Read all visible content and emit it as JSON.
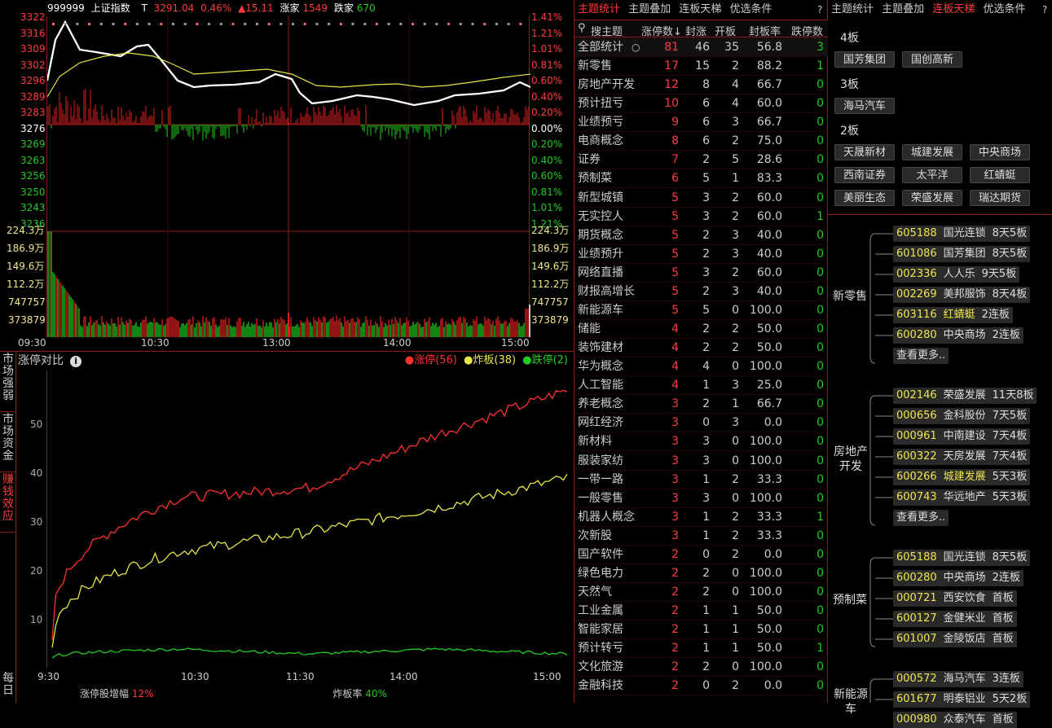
{
  "index_bar": {
    "code": "999999",
    "name": "上证指数",
    "tag": "T",
    "price": "3291.04",
    "pct": "0.46%",
    "change": "▲15.11",
    "up_label": "涨家",
    "up_count": "1549",
    "down_label": "跌家",
    "down_count": "670"
  },
  "price_axis_left": [
    "3322",
    "3316",
    "3309",
    "3302",
    "3296",
    "3289",
    "3283",
    "3276",
    "3269",
    "3263",
    "3256",
    "3250",
    "3243",
    "3236"
  ],
  "price_axis_right": [
    "1.41%",
    "1.21%",
    "1.01%",
    "0.81%",
    "0.60%",
    "0.40%",
    "0.20%",
    "0.00%",
    "0.20%",
    "0.40%",
    "0.60%",
    "0.81%",
    "1.01%",
    "1.21%"
  ],
  "volume_axis": [
    "224.3万",
    "186.9万",
    "149.6万",
    "112.2万",
    "747757",
    "373879"
  ],
  "time_axis": [
    "09:30",
    "10:30",
    "13:00",
    "14:00",
    "15:00"
  ],
  "side_tabs": [
    "市场强弱",
    "市场资金",
    "赚钱效应",
    "每日"
  ],
  "panel2": {
    "title": "涨停对比",
    "legend": [
      {
        "label": "涨停(56)",
        "color": "#ff3030"
      },
      {
        "label": "炸板(38)",
        "color": "#e6e64a"
      },
      {
        "label": "跌停(2)",
        "color": "#22cc22"
      }
    ],
    "footer_a_label": "涨停股增幅",
    "footer_a_value": "12%",
    "footer_b_label": "炸板率",
    "footer_b_value": "40%",
    "x_ticks": [
      "9:30",
      "10:30",
      "11:30",
      "14:00",
      "15:00"
    ],
    "y_ticks": [
      "50",
      "40",
      "30",
      "20",
      "10"
    ]
  },
  "chart_data": {
    "type": "line",
    "x": [
      "9:30",
      "10:30",
      "11:30",
      "14:00",
      "15:00"
    ],
    "ylim": [
      0,
      60
    ],
    "series": [
      {
        "name": "涨停(56)",
        "color": "#ff3030",
        "values": [
          5,
          34,
          36,
          47,
          56
        ]
      },
      {
        "name": "炸板(38)",
        "color": "#e6e64a",
        "values": [
          3,
          23,
          27,
          32,
          38
        ]
      },
      {
        "name": "跌停(2)",
        "color": "#22cc22",
        "values": [
          1,
          3,
          2,
          3,
          2
        ]
      }
    ]
  },
  "mid": {
    "tabs": [
      "主题统计",
      "主题叠加",
      "连板天梯",
      "优选条件",
      "?"
    ],
    "search_placeholder": "搜主题",
    "headers": [
      "涨停数↓",
      "封涨",
      "开板",
      "封板率",
      "跌停数"
    ],
    "rows": [
      [
        "全部统计",
        "81",
        "46",
        "35",
        "56.8",
        "3"
      ],
      [
        "新零售",
        "17",
        "15",
        "2",
        "88.2",
        "1"
      ],
      [
        "房地产开发",
        "12",
        "8",
        "4",
        "66.7",
        "0"
      ],
      [
        "预计扭亏",
        "10",
        "6",
        "4",
        "60.0",
        "0"
      ],
      [
        "业绩预亏",
        "9",
        "6",
        "3",
        "66.7",
        "0"
      ],
      [
        "电商概念",
        "8",
        "6",
        "2",
        "75.0",
        "0"
      ],
      [
        "证券",
        "7",
        "2",
        "5",
        "28.6",
        "0"
      ],
      [
        "预制菜",
        "6",
        "5",
        "1",
        "83.3",
        "0"
      ],
      [
        "新型城镇",
        "5",
        "3",
        "2",
        "60.0",
        "0"
      ],
      [
        "无实控人",
        "5",
        "3",
        "2",
        "60.0",
        "1"
      ],
      [
        "期货概念",
        "5",
        "2",
        "3",
        "40.0",
        "0"
      ],
      [
        "业绩预升",
        "5",
        "2",
        "3",
        "40.0",
        "0"
      ],
      [
        "网络直播",
        "5",
        "3",
        "2",
        "60.0",
        "0"
      ],
      [
        "财报高增长",
        "5",
        "2",
        "3",
        "40.0",
        "0"
      ],
      [
        "新能源车",
        "5",
        "5",
        "0",
        "100.0",
        "0"
      ],
      [
        "储能",
        "4",
        "2",
        "2",
        "50.0",
        "0"
      ],
      [
        "装饰建材",
        "4",
        "2",
        "2",
        "50.0",
        "0"
      ],
      [
        "华为概念",
        "4",
        "4",
        "0",
        "100.0",
        "0"
      ],
      [
        "人工智能",
        "4",
        "1",
        "3",
        "25.0",
        "0"
      ],
      [
        "养老概念",
        "3",
        "2",
        "1",
        "66.7",
        "0"
      ],
      [
        "网红经济",
        "3",
        "0",
        "3",
        "0.0",
        "0"
      ],
      [
        "新材料",
        "3",
        "3",
        "0",
        "100.0",
        "0"
      ],
      [
        "服装家纺",
        "3",
        "3",
        "0",
        "100.0",
        "0"
      ],
      [
        "一带一路",
        "3",
        "1",
        "2",
        "33.3",
        "0"
      ],
      [
        "一般零售",
        "3",
        "3",
        "0",
        "100.0",
        "0"
      ],
      [
        "机器人概念",
        "3",
        "1",
        "2",
        "33.3",
        "1"
      ],
      [
        "次新股",
        "3",
        "1",
        "2",
        "33.3",
        "0"
      ],
      [
        "国产软件",
        "2",
        "0",
        "2",
        "0.0",
        "0"
      ],
      [
        "绿色电力",
        "2",
        "2",
        "0",
        "100.0",
        "0"
      ],
      [
        "天然气",
        "2",
        "2",
        "0",
        "100.0",
        "0"
      ],
      [
        "工业金属",
        "2",
        "1",
        "1",
        "50.0",
        "0"
      ],
      [
        "智能家居",
        "2",
        "1",
        "1",
        "50.0",
        "0"
      ],
      [
        "预计转亏",
        "2",
        "1",
        "1",
        "50.0",
        "1"
      ],
      [
        "文化旅游",
        "2",
        "2",
        "0",
        "100.0",
        "0"
      ],
      [
        "金融科技",
        "2",
        "0",
        "2",
        "0.0",
        "0"
      ]
    ]
  },
  "right": {
    "tabs": [
      "主题统计",
      "主题叠加",
      "连板天梯",
      "优选条件",
      "?"
    ],
    "levels": [
      {
        "title": "4板",
        "chips": [
          "国芳集团",
          "国创高新"
        ]
      },
      {
        "title": "3板",
        "chips": [
          "海马汽车"
        ]
      },
      {
        "title": "2板",
        "chips": [
          "天晟新材",
          "城建发展",
          "中央商场",
          "西南证券",
          "太平洋",
          "红蜻蜓",
          "美丽生态",
          "荣盛发展",
          "瑞达期货"
        ]
      }
    ],
    "groups": [
      {
        "name": "新零售",
        "stocks": [
          [
            "605188",
            "国光连锁",
            "8天5板"
          ],
          [
            "601086",
            "国芳集团",
            "8天5板"
          ],
          [
            "002336",
            "人人乐",
            "9天5板"
          ],
          [
            "002269",
            "美邦服饰",
            "8天4板"
          ],
          [
            "603116",
            "红蜻蜓",
            "2连板"
          ],
          [
            "600280",
            "中央商场",
            "2连板"
          ]
        ],
        "more": "查看更多.."
      },
      {
        "name": "房地产开发",
        "stocks": [
          [
            "002146",
            "荣盛发展",
            "11天8板"
          ],
          [
            "000656",
            "金科股份",
            "7天5板"
          ],
          [
            "000961",
            "中南建设",
            "7天4板"
          ],
          [
            "600322",
            "天房发展",
            "7天4板"
          ],
          [
            "600266",
            "城建发展",
            "5天3板"
          ],
          [
            "600743",
            "华远地产",
            "5天3板"
          ]
        ],
        "more": "查看更多.."
      },
      {
        "name": "预制菜",
        "stocks": [
          [
            "605188",
            "国光连锁",
            "8天5板"
          ],
          [
            "600280",
            "中央商场",
            "2连板"
          ],
          [
            "000721",
            "西安饮食",
            "首板"
          ],
          [
            "600127",
            "金健米业",
            "首板"
          ],
          [
            "601007",
            "金陵饭店",
            "首板"
          ]
        ],
        "more": ""
      },
      {
        "name": "新能源车",
        "stocks": [
          [
            "000572",
            "海马汽车",
            "3连板"
          ],
          [
            "601677",
            "明泰铝业",
            "5天2板"
          ],
          [
            "000980",
            "众泰汽车",
            "首板"
          ]
        ],
        "more": ""
      }
    ]
  }
}
